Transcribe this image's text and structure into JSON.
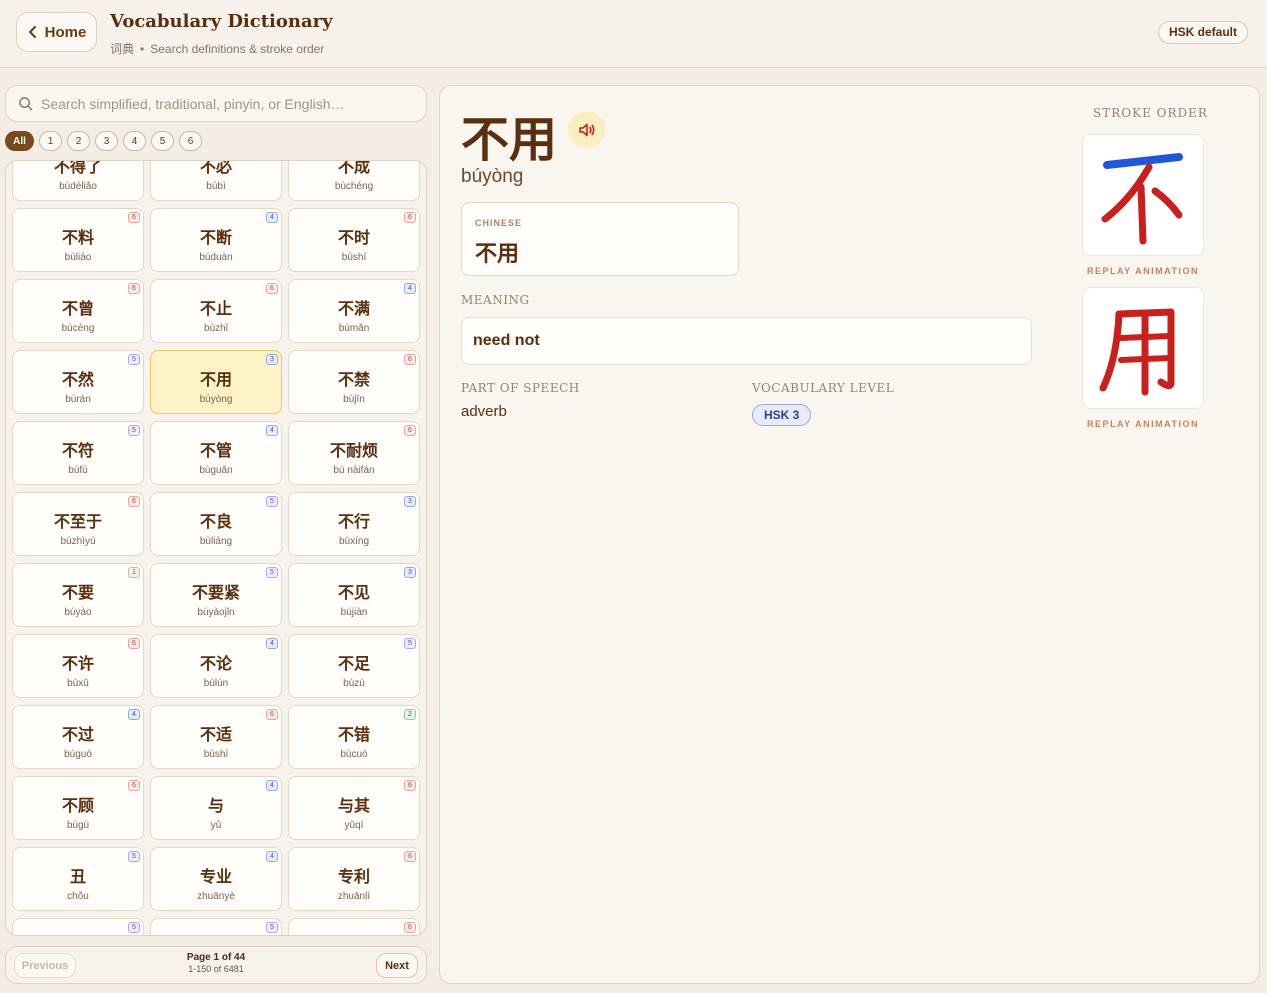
{
  "header": {
    "home_label": "Home",
    "title": "Vocabulary Dictionary",
    "subtitle_zh": "词典",
    "subtitle_sep": "•",
    "subtitle_en": "Search definitions & stroke order",
    "hsk_button": "HSK default"
  },
  "search": {
    "placeholder": "Search simplified, traditional, pinyin, or English…"
  },
  "filters": [
    "All",
    "1",
    "2",
    "3",
    "4",
    "5",
    "6"
  ],
  "list": {
    "cards": [
      {
        "hz": "不得了",
        "py": "bùdéliǎo",
        "level": ""
      },
      {
        "hz": "不必",
        "py": "búbì",
        "level": ""
      },
      {
        "hz": "不成",
        "py": "bùchéng",
        "level": ""
      },
      {
        "hz": "不料",
        "py": "búliào",
        "level": "6"
      },
      {
        "hz": "不断",
        "py": "búduàn",
        "level": "4"
      },
      {
        "hz": "不时",
        "py": "bùshí",
        "level": "6"
      },
      {
        "hz": "不曾",
        "py": "bùcéng",
        "level": "6"
      },
      {
        "hz": "不止",
        "py": "bùzhǐ",
        "level": "6"
      },
      {
        "hz": "不满",
        "py": "bùmǎn",
        "level": "4"
      },
      {
        "hz": "不然",
        "py": "bùrán",
        "level": "5"
      },
      {
        "hz": "不用",
        "py": "búyòng",
        "level": "3",
        "selected": true
      },
      {
        "hz": "不禁",
        "py": "bùjīn",
        "level": "6"
      },
      {
        "hz": "不符",
        "py": "bùfú",
        "level": "5"
      },
      {
        "hz": "不管",
        "py": "bùguǎn",
        "level": "4"
      },
      {
        "hz": "不耐烦",
        "py": "bú nàifán",
        "level": "6"
      },
      {
        "hz": "不至于",
        "py": "búzhìyú",
        "level": "6"
      },
      {
        "hz": "不良",
        "py": "bùliáng",
        "level": "5"
      },
      {
        "hz": "不行",
        "py": "bùxíng",
        "level": "3"
      },
      {
        "hz": "不要",
        "py": "búyào",
        "level": "1"
      },
      {
        "hz": "不要紧",
        "py": "búyàojǐn",
        "level": "5"
      },
      {
        "hz": "不见",
        "py": "bújiàn",
        "level": "3"
      },
      {
        "hz": "不许",
        "py": "bùxǔ",
        "level": "6"
      },
      {
        "hz": "不论",
        "py": "búlùn",
        "level": "4"
      },
      {
        "hz": "不足",
        "py": "bùzú",
        "level": "5"
      },
      {
        "hz": "不过",
        "py": "búguò",
        "level": "4"
      },
      {
        "hz": "不适",
        "py": "búshì",
        "level": "6"
      },
      {
        "hz": "不错",
        "py": "búcuò",
        "level": "2"
      },
      {
        "hz": "不顾",
        "py": "búgù",
        "level": "6"
      },
      {
        "hz": "与",
        "py": "yǔ",
        "level": "4"
      },
      {
        "hz": "与其",
        "py": "yǔqí",
        "level": "6"
      },
      {
        "hz": "丑",
        "py": "chǒu",
        "level": "5"
      },
      {
        "hz": "专业",
        "py": "zhuānyè",
        "level": "4"
      },
      {
        "hz": "专利",
        "py": "zhuānlì",
        "level": "6"
      },
      {
        "hz": "",
        "py": "",
        "level": "5"
      },
      {
        "hz": "",
        "py": "",
        "level": "5"
      },
      {
        "hz": "",
        "py": "",
        "level": "6"
      }
    ]
  },
  "pager": {
    "prev_label": "Previous",
    "next_label": "Next",
    "page_text": "Page 1 of 44",
    "range_text": "1-150 of 6481"
  },
  "detail": {
    "hanzi": "不用",
    "pinyin": "búyòng",
    "chinese_label": "CHINESE",
    "chinese_value": "不用",
    "meaning_label": "MEANING",
    "meaning": "need not",
    "pos_label": "PART OF SPEECH",
    "pos_value": "adverb",
    "level_label": "VOCABULARY LEVEL",
    "level_value": "HSK 3",
    "stroke_title": "STROKE ORDER",
    "replay_label": "REPLAY ANIMATION",
    "stroke_chars": [
      "不",
      "用"
    ]
  },
  "colors": {
    "accent_brown": "#5a2f0f",
    "stroke_red": "#c8201c",
    "stroke_blue": "#2156d6"
  }
}
